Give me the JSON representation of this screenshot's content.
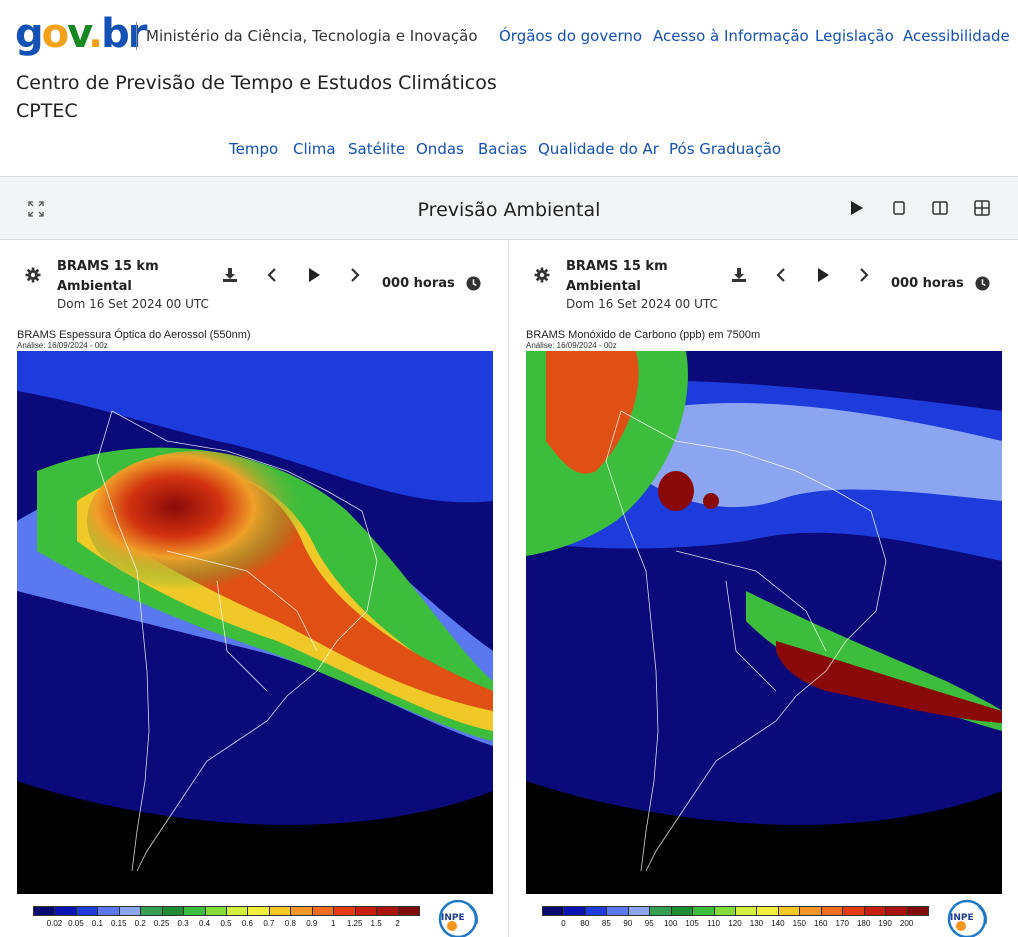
{
  "header": {
    "logo_parts": [
      "g",
      "o",
      "v",
      ".",
      "br"
    ],
    "ministry": "Ministério da Ciência, Tecnologia e Inovação",
    "links": [
      "Órgãos do governo",
      "Acesso à Informação",
      "Legislação",
      "Acessibilidade"
    ]
  },
  "site": {
    "title": "Centro de Previsão de Tempo e Estudos Climáticos",
    "subtitle": "CPTEC"
  },
  "nav": [
    "Tempo",
    "Clima",
    "Satélite",
    "Ondas",
    "Bacias",
    "Qualidade do Ar",
    "Pós Graduação"
  ],
  "toolbar": {
    "title": "Previsão Ambiental",
    "icons": [
      "expand-icon",
      "play-icon",
      "single-layout-icon",
      "two-column-layout-icon",
      "grid-layout-icon"
    ]
  },
  "panels": [
    {
      "model": "BRAMS 15 km Ambiental",
      "date": "Dom 16 Set 2024 00 UTC",
      "hours": "000 horas",
      "map_title": "BRAMS Espessura Óptica do Aerossol (550nm)",
      "map_analysis": "Análise: 16/09/2024 - 00z",
      "colorbar_labels": [
        "0.02",
        "0.05",
        "0.1",
        "0.15",
        "0.2",
        "0.25",
        "0.3",
        "0.4",
        "0.5",
        "0.6",
        "0.7",
        "0.8",
        "0.9",
        "1",
        "1.25",
        "1.5",
        "2"
      ],
      "colorbar_colors": [
        "#0a0a6e",
        "#0a14b4",
        "#1e3cdc",
        "#5a78f0",
        "#8ca5f0",
        "#32a050",
        "#1e8c32",
        "#3cbe3c",
        "#82dc3c",
        "#d2f03c",
        "#f0f03c",
        "#f5c828",
        "#f59628",
        "#f06e1e",
        "#e63c14",
        "#c81e0a",
        "#aa140a",
        "#820a0a"
      ]
    },
    {
      "model": "BRAMS 15 km Ambiental",
      "date": "Dom 16 Set 2024 00 UTC",
      "hours": "000 horas",
      "map_title": "BRAMS Monóxido de Carbono (ppb) em 7500m",
      "map_analysis": "Análise: 16/09/2024 - 00z",
      "colorbar_labels": [
        "0",
        "80",
        "85",
        "90",
        "95",
        "100",
        "105",
        "110",
        "120",
        "130",
        "140",
        "150",
        "160",
        "170",
        "180",
        "190",
        "200"
      ],
      "colorbar_colors": [
        "#0a0a6e",
        "#0a14b4",
        "#1e3cdc",
        "#5a78f0",
        "#8ca5f0",
        "#32a050",
        "#1e8c32",
        "#3cbe3c",
        "#82dc3c",
        "#d2f03c",
        "#f0f03c",
        "#f5c828",
        "#f59628",
        "#f06e1e",
        "#e63c14",
        "#c81e0a",
        "#aa140a",
        "#820a0a"
      ]
    }
  ],
  "logo_badge": "INPE",
  "colors": {
    "link": "#1351b4",
    "toolbar_bg": "#f3f4f5",
    "ocean": "#0a0a7a"
  }
}
